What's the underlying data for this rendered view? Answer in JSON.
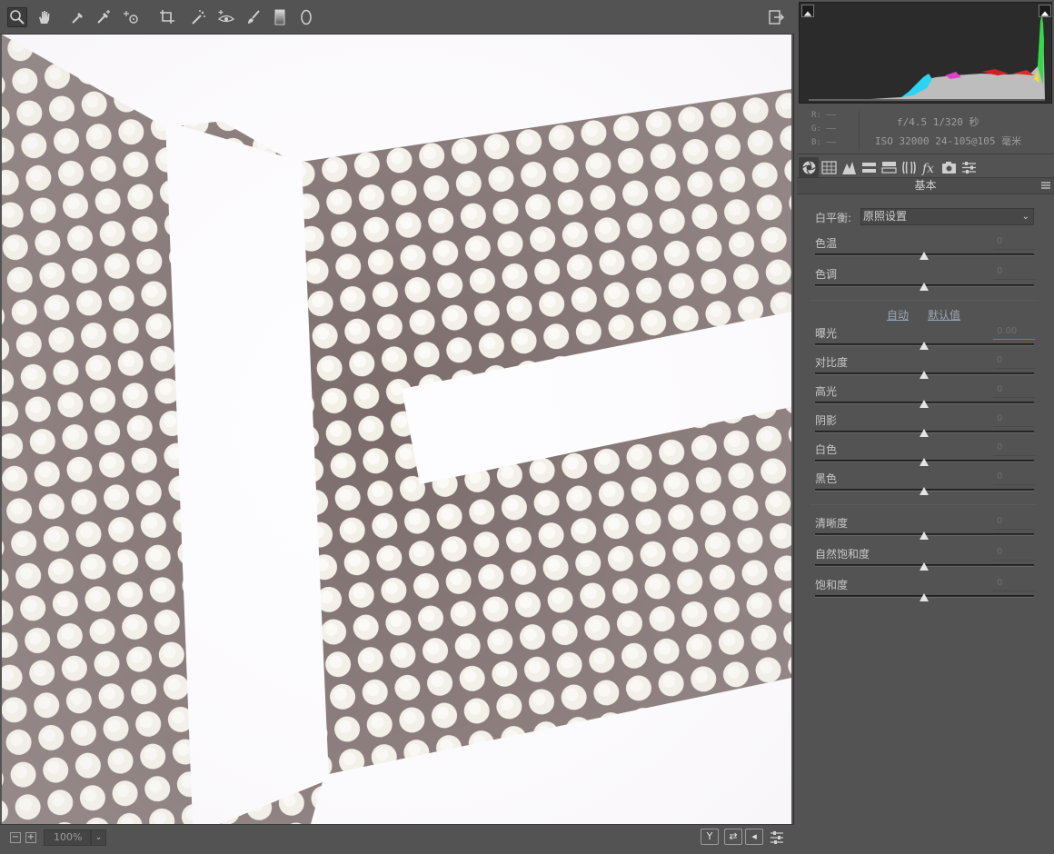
{
  "toolbar": {
    "tools": [
      "zoom-icon",
      "hand-icon",
      "white-balance-icon",
      "color-sampler-icon",
      "target-adjust-icon",
      "crop-icon",
      "spot-removal-icon",
      "red-eye-icon",
      "adjustment-brush-icon",
      "graduated-filter-icon",
      "radial-filter-icon"
    ],
    "active_tool": "zoom-icon",
    "right_icon": "open-preferences-icon"
  },
  "bottom": {
    "zoom_minus": "−",
    "zoom_plus": "+",
    "zoom_value": "100%",
    "zoom_dropdown": "⌄",
    "view_mode_y": "Y",
    "swap_label": "⇄",
    "copy_label": "◂"
  },
  "histogram": {
    "clip_shadow": "shadow-clipping-icon",
    "clip_highlight": "highlight-clipping-icon"
  },
  "info": {
    "r_label": "R: ——",
    "g_label": "G: ——",
    "b_label": "B: ——",
    "aperture_shutter": "f/4.5  1/320 秒",
    "iso_lens": "ISO 32000  24-105@105 毫米"
  },
  "panel_tabs": [
    "basic-icon",
    "tone-curve-icon",
    "detail-icon",
    "hsl-icon",
    "split-toning-icon",
    "lens-icon",
    "effects-icon",
    "camera-calibration-icon",
    "presets-icon"
  ],
  "panel": {
    "title": "基本",
    "white_balance_label": "白平衡:",
    "white_balance_value": "原照设置",
    "auto_link": "自动",
    "default_link": "默认值",
    "sliders_wb": [
      {
        "label": "色温",
        "value": "0"
      },
      {
        "label": "色调",
        "value": "0"
      }
    ],
    "sliders_tone": [
      {
        "label": "曝光",
        "value": "0.00"
      },
      {
        "label": "对比度",
        "value": "0"
      },
      {
        "label": "高光",
        "value": "0"
      },
      {
        "label": "阴影",
        "value": "0"
      },
      {
        "label": "白色",
        "value": "0"
      },
      {
        "label": "黑色",
        "value": "0"
      }
    ],
    "sliders_presence": [
      {
        "label": "清晰度",
        "value": "0"
      },
      {
        "label": "自然饱和度",
        "value": "0"
      },
      {
        "label": "饱和度",
        "value": "0"
      }
    ]
  },
  "colors": {
    "background": "#535353",
    "canvas_dot": "#f4f1ea",
    "canvas_ground": "#7e6e6c",
    "histogram_bg": "#2b2b2b"
  }
}
